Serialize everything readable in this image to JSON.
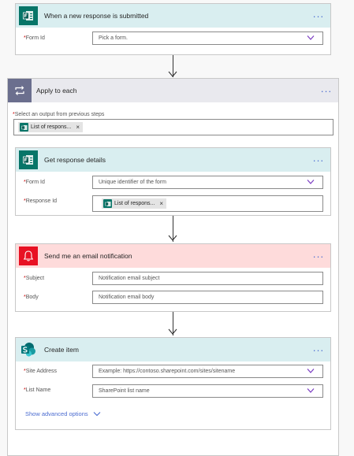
{
  "trigger": {
    "title": "When a new response is submitted",
    "icon": "forms-icon",
    "fields": [
      {
        "label": "Form Id",
        "placeholder": "Pick a form."
      }
    ]
  },
  "apply_each": {
    "title": "Apply to each",
    "icon": "loop-icon",
    "output_label": "Select an output from previous steps",
    "output_token": "List of respons..."
  },
  "get_response": {
    "title": "Get response details",
    "icon": "forms-icon",
    "form_id_label": "Form Id",
    "form_id_placeholder": "Unique identifier of the form",
    "response_id_label": "Response Id",
    "response_id_token": "List of respons..."
  },
  "email": {
    "title": "Send me an email notification",
    "icon": "bell-icon",
    "subject_label": "Subject",
    "subject_placeholder": "Notification email subject",
    "body_label": "Body",
    "body_placeholder": "Notification email body"
  },
  "create_item": {
    "title": "Create item",
    "icon": "sharepoint-icon",
    "site_label": "Site Address",
    "site_placeholder": "Example: https://contoso.sharepoint.com/sites/sitename",
    "list_label": "List Name",
    "list_placeholder": "SharePoint list name",
    "advanced_link": "Show advanced options"
  },
  "more_label": "···",
  "required_mark": "*",
  "token_close": "×",
  "colors": {
    "forms_header": "#d9eef0",
    "forms_icon": "#077568",
    "loop_header": "#e9e9ee",
    "loop_icon": "#6b6f8e",
    "email_header": "#fedbdb",
    "email_icon": "#e81123",
    "sharepoint_header": "#d9eef0",
    "sharepoint_icon": "#038387",
    "link": "#4a6bd0"
  }
}
